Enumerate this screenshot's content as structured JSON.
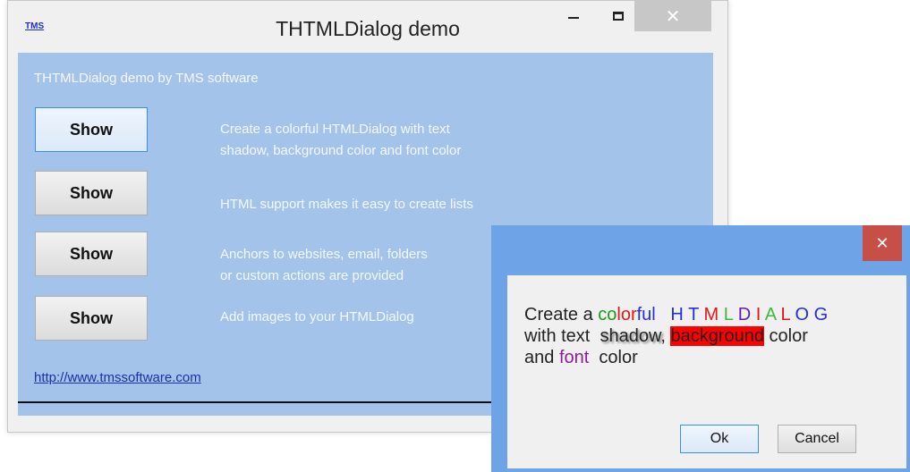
{
  "main_window": {
    "icon_text": "TMS",
    "title": "THTMLDialog demo",
    "heading": "THTMLDialog demo by TMS software",
    "link": "http://www.tmssoftware.com",
    "rows": [
      {
        "button": "Show",
        "desc_line1": "Create a colorful HTMLDialog with text",
        "desc_line2": "shadow, background color and font color"
      },
      {
        "button": "Show",
        "desc_line1": "HTML support makes it easy to create lists",
        "desc_line2": ""
      },
      {
        "button": "Show",
        "desc_line1": "Anchors to websites, email, folders",
        "desc_line2": "or custom actions are provided"
      },
      {
        "button": "Show",
        "desc_line1": "Add images to your HTMLDialog",
        "desc_line2": ""
      }
    ]
  },
  "dialog": {
    "text": {
      "create_a": "Create a ",
      "colorful_parts": [
        "co",
        "lor",
        "ful"
      ],
      "htmldialog_letters": [
        "H",
        "T",
        "M",
        "L",
        "D",
        "I",
        "A",
        "L",
        "O",
        "G"
      ],
      "with_text": "with text ",
      "shadow": "shadow",
      "comma": ",",
      "background": "background",
      "color1": " color",
      "and": "and ",
      "font": "font",
      "color2": "  color"
    },
    "ok_label": "Ok",
    "cancel_label": "Cancel"
  },
  "colors": {
    "client_bg": "#a4c3ea",
    "dialog_frame": "#6ea3e8",
    "close_red": "#c64f48",
    "highlight_bg": "#ff0000"
  }
}
